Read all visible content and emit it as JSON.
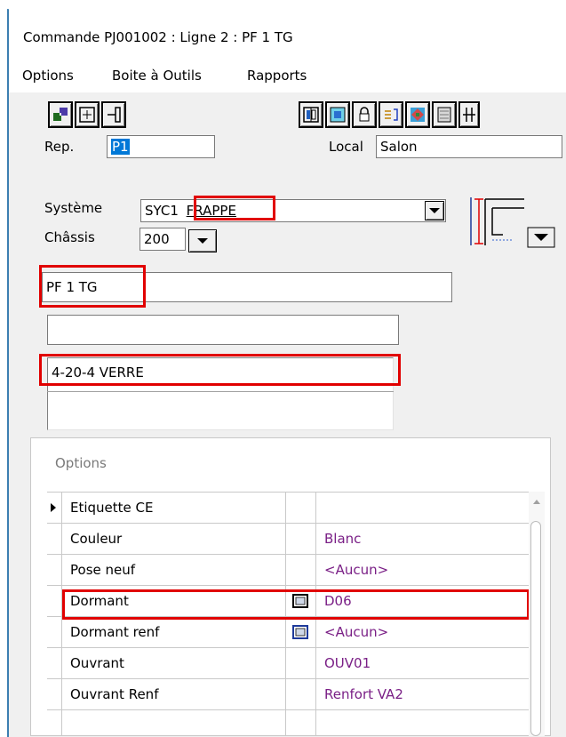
{
  "window": {
    "title": "Commande PJ001002 : Ligne  2 : PF 1 TG"
  },
  "menu": [
    "Options",
    "Boite à Outils",
    "Rapports"
  ],
  "toolbar_left": [
    "window-split-icon",
    "grid-cross-icon",
    "frame-handle-icon"
  ],
  "toolbar_right": [
    "mullion-icon",
    "glass-pane-icon",
    "lock-icon",
    "list-align-icon",
    "colored-window-icon",
    "shutter-icon",
    "grille-icon"
  ],
  "form": {
    "rep_label": "Rep.",
    "rep_value": "P1",
    "local_label": "Local",
    "local_value": "Salon",
    "systeme_label": "Système",
    "systeme_value_prefix": "SYC1",
    "systeme_value_suffix": "FRAPPE",
    "chassis_label": "Châssis",
    "chassis_value": "200",
    "designation": "PF 1 TG",
    "line2": "",
    "vitrage": "4-20-4 VERRE",
    "comment": ""
  },
  "options_grid": {
    "title": "Options",
    "rows": [
      {
        "name": "Etiquette CE",
        "value": "",
        "has_icon": false,
        "current": true
      },
      {
        "name": "Couleur",
        "value": "Blanc",
        "has_icon": false
      },
      {
        "name": "Pose neuf",
        "value": "<Aucun>",
        "has_icon": false
      },
      {
        "name": "Dormant",
        "value": "D06",
        "has_icon": true
      },
      {
        "name": "Dormant renf",
        "value": "<Aucun>",
        "has_icon": true
      },
      {
        "name": "Ouvrant",
        "value": "OUV01",
        "has_icon": false
      },
      {
        "name": "Ouvrant Renf",
        "value": "Renfort VA2",
        "has_icon": false
      }
    ]
  },
  "colors": {
    "highlight_red": "#e10000",
    "value_purple": "#7a1f86",
    "selection_blue": "#0078d7"
  }
}
